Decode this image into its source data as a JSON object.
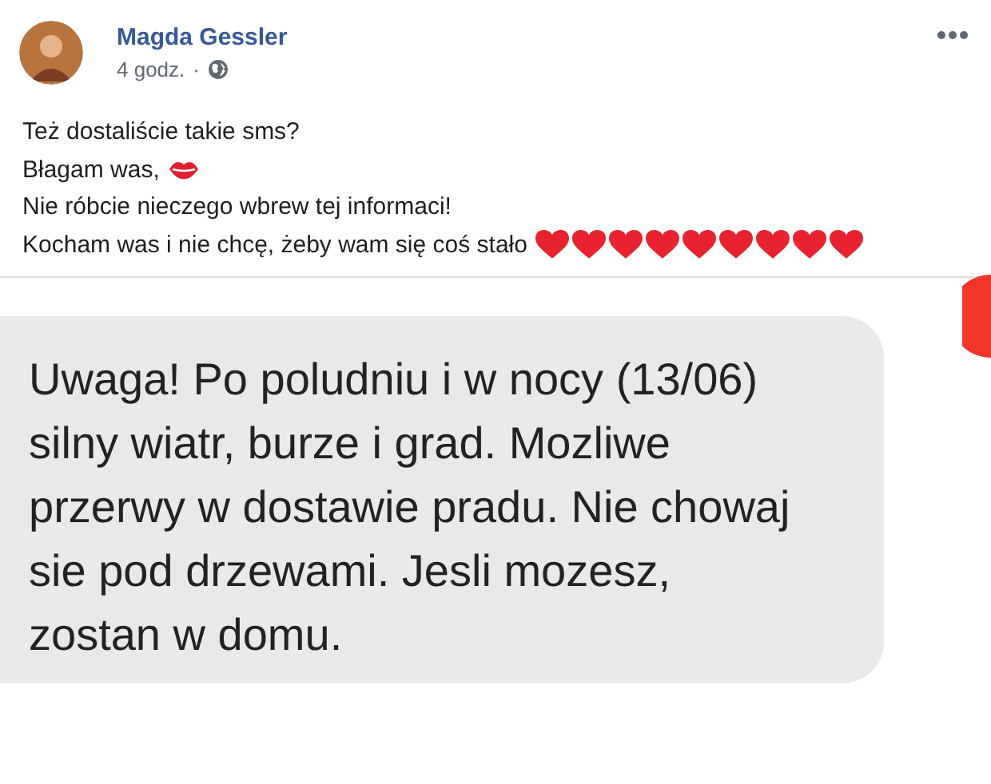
{
  "post": {
    "author": "Magda Gessler",
    "time": "4 godz.",
    "separator": "·",
    "lines": [
      {
        "text": "Też dostaliście takie sms?",
        "kind": "plain"
      },
      {
        "text": "Błagam was,",
        "kind": "lips"
      },
      {
        "text": "Nie róbcie nieczego wbrew tej informaci!",
        "kind": "plain"
      },
      {
        "text": "Kocham was i nie chcę, żeby wam się coś stało",
        "kind": "hearts"
      }
    ]
  },
  "attachment": {
    "message": "Uwaga! Po poludniu i w nocy (13/06) silny wiatr, burze i grad. Mozliwe przerwy w dostawie pradu. Nie chowaj sie pod drzewami. Jesli mozesz, zostan w domu."
  }
}
